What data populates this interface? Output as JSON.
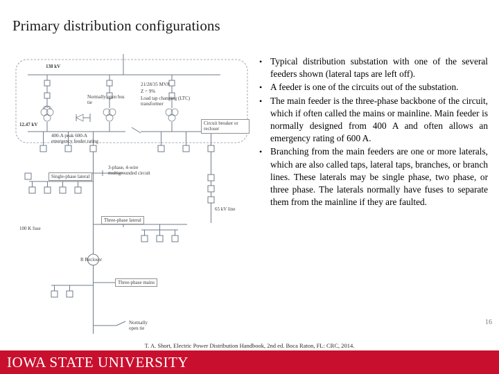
{
  "slide": {
    "title": "Primary distribution configurations",
    "page_number": "16",
    "citation": "T. A. Short, Electric Power Distribution Handbook, 2nd ed. Boca Raton, FL: CRC, 2014.",
    "footer_brand": "IOWA STATE UNIVERSITY",
    "brand_color": "#c8102e"
  },
  "bullets": [
    {
      "marker": "•",
      "text": "Typical distribution substation with one of the several feeders shown (lateral taps are left off)."
    },
    {
      "marker": "•",
      "text": "A feeder is one of the circuits out of the substation."
    },
    {
      "marker": "•",
      "text": "The main feeder is the three-phase backbone of the circuit, which if often called the mains or mainline. Main feeder is normally designed from 400 A and often allows an emergency rating of 600 A."
    },
    {
      "marker": "•",
      "text": "Branching from the main feeders are one or more laterals, which are also called taps, lateral taps, branches, or branch lines. These laterals may be single phase, two phase, or three phase. The laterals normally have fuses to separate them from the mainline if they are faulted."
    }
  ],
  "figure": {
    "alt": "One-line diagram of a typical distribution substation and feeder",
    "labels": {
      "hv_bus": "138 kV",
      "mv_bus": "12.47 kV",
      "transformer_rating": "21/28/35 MVA",
      "transformer_z": "Z = 9%",
      "transformer_ltc": "Load tap changing (LTC) transformer",
      "normally_open_bus_tie": "Normally open bus tie",
      "circuit_breaker": "Circuit breaker or recloser",
      "feeder_rating": "400-A peak 600-A emergency feeder rating",
      "single_phase_lateral": "Single-phase lateral",
      "three_wire": "3-phase, 4-wire multigrounded circuit",
      "three_phase_lateral": "Three-phase lateral",
      "fuse": "100 K fuse",
      "recloser": "R  Recloser",
      "three_phase_mains": "Three-phase mains",
      "normally_open_tie": "Normally open tie",
      "line_65kv": "65 kV line"
    }
  }
}
